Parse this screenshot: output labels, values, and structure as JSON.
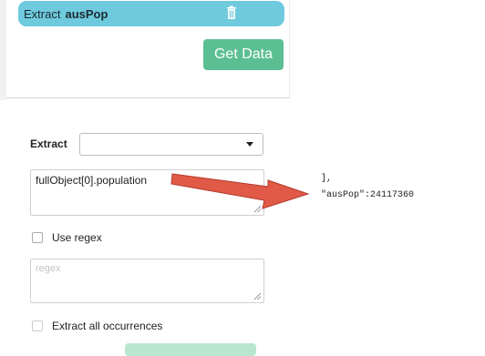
{
  "extract_pill": {
    "label": "Extract",
    "value": "ausPop",
    "delete_icon": "trash-icon"
  },
  "get_data_button": {
    "label": "Get Data"
  },
  "extract_field": {
    "label": "Extract",
    "selected": ""
  },
  "path_input": {
    "value": "fullObject[0].population"
  },
  "use_regex": {
    "label": "Use regex",
    "checked": false
  },
  "regex_input": {
    "placeholder": "regex"
  },
  "extract_all": {
    "label": "Extract all occurrences",
    "checked": false
  },
  "json_preview": {
    "lines": [
      "],",
      "\"ausPop\":24117360"
    ]
  },
  "colors": {
    "pill": "#6fcadd",
    "primary_button": "#5cbf93",
    "arrow": "#e05a47"
  }
}
